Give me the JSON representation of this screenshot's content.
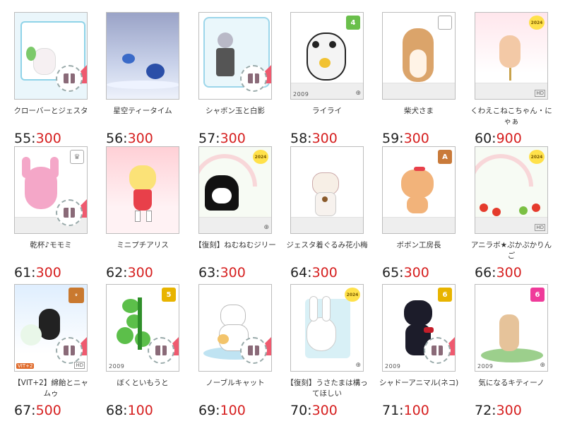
{
  "items": [
    {
      "label": "クローバーとジェスタ",
      "num": "55:",
      "cost": "300",
      "badge": "",
      "year": ""
    },
    {
      "label": "星空ティータイム",
      "num": "56:",
      "cost": "300",
      "badge": "",
      "year": ""
    },
    {
      "label": "シャボン玉と白影",
      "num": "57:",
      "cost": "300",
      "badge": "",
      "year": ""
    },
    {
      "label": "ライライ",
      "num": "58:",
      "cost": "300",
      "badge": "4",
      "year": "2009"
    },
    {
      "label": "柴犬さま",
      "num": "59:",
      "cost": "300",
      "badge": "",
      "year": ""
    },
    {
      "label": "くわえこねこちゃん・にゃぁ",
      "num": "60:",
      "cost": "900",
      "badge": "2024",
      "year": ""
    },
    {
      "label": "乾杯♪モモミ",
      "num": "61:",
      "cost": "300",
      "badge": "",
      "year": ""
    },
    {
      "label": "ミニプチアリス",
      "num": "62:",
      "cost": "300",
      "badge": "",
      "year": ""
    },
    {
      "label": "【復刻】ねむねむジリー",
      "num": "63:",
      "cost": "300",
      "badge": "2024",
      "year": ""
    },
    {
      "label": "ジェスタ着ぐるみ花小梅",
      "num": "64:",
      "cost": "300",
      "badge": "",
      "year": ""
    },
    {
      "label": "ボボン工房長",
      "num": "65:",
      "cost": "300",
      "badge": "",
      "year": ""
    },
    {
      "label": "アニラボ★ぷかぷかりんご",
      "num": "66:",
      "cost": "300",
      "badge": "2024",
      "year": ""
    },
    {
      "label": "【VIT+2】綿飴とニャムゥ",
      "num": "67:",
      "cost": "500",
      "badge": "CHOCO",
      "year": ""
    },
    {
      "label": "ぼくといもうと",
      "num": "68:",
      "cost": "100",
      "badge": "5",
      "year": "2009"
    },
    {
      "label": "ノーブルキャット",
      "num": "69:",
      "cost": "100",
      "badge": "",
      "year": ""
    },
    {
      "label": "【復刻】うさたまは構ってほしい",
      "num": "70:",
      "cost": "300",
      "badge": "2024",
      "year": ""
    },
    {
      "label": "シャドーアニマル(ネコ)",
      "num": "71:",
      "cost": "100",
      "badge": "6",
      "year": "2009"
    },
    {
      "label": "気になるキティーノ",
      "num": "72:",
      "cost": "300",
      "badge": "6",
      "year": "2009"
    }
  ],
  "icons": {
    "gift": "gift-icon",
    "zoom": "zoom-icon",
    "crown": "crown-icon"
  },
  "vit_label": "VIT+2",
  "hd_label": "HD",
  "colors": {
    "price_red": "#d62020",
    "border": "#bdbdbd"
  }
}
